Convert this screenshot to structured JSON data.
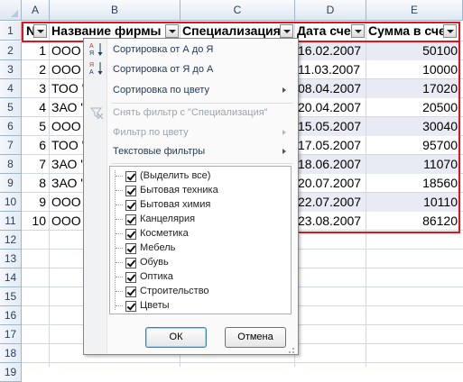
{
  "columns": [
    "A",
    "B",
    "C",
    "D",
    "E"
  ],
  "rows": [
    "1",
    "2",
    "3",
    "4",
    "5",
    "6",
    "7",
    "8",
    "9",
    "10",
    "11",
    "12",
    "13",
    "14",
    "15",
    "16",
    "17",
    "18",
    "19"
  ],
  "header": {
    "a": "N",
    "b": "Название фирмы",
    "c": "Специализация",
    "d": "Дата сче",
    "e": "Сумма в сче"
  },
  "data_rows": [
    {
      "num": "1",
      "firm": "ООО",
      "date": "16.02.2007",
      "sum": "50100"
    },
    {
      "num": "2",
      "firm": "ООО",
      "date": "11.03.2007",
      "sum": "10000"
    },
    {
      "num": "3",
      "firm": "ТОО '",
      "date": "08.04.2007",
      "sum": "17020"
    },
    {
      "num": "4",
      "firm": "ЗАО '",
      "date": "20.04.2007",
      "sum": "20500"
    },
    {
      "num": "5",
      "firm": "ООО",
      "date": "15.05.2007",
      "sum": "30040"
    },
    {
      "num": "6",
      "firm": "ТОО '",
      "date": "17.05.2007",
      "sum": "95700"
    },
    {
      "num": "7",
      "firm": "ЗАО '",
      "date": "18.06.2007",
      "sum": "11070"
    },
    {
      "num": "8",
      "firm": "ЗАО '",
      "date": "20.07.2007",
      "sum": "18560"
    },
    {
      "num": "9",
      "firm": "ООО",
      "date": "22.07.2007",
      "sum": "10110"
    },
    {
      "num": "10",
      "firm": "ООО",
      "date": "23.08.2007",
      "sum": "86120"
    }
  ],
  "menu": {
    "sort_asc": "Сортировка от А до Я",
    "sort_desc": "Сортировка от Я до А",
    "sort_color": "Сортировка по цвету",
    "clear_filter": "Снять фильтр с \"Специализация\"",
    "filter_color": "Фильтр по цвету",
    "text_filters": "Текстовые фильтры",
    "icon_sort_asc": "sort-a-z-icon",
    "icon_sort_desc": "sort-z-a-icon",
    "icon_clear": "clear-filter-icon"
  },
  "filter_values": [
    "(Выделить все)",
    "Бытовая техника",
    "Бытовая химия",
    "Канцелярия",
    "Косметика",
    "Мебель",
    "Обувь",
    "Оптика",
    "Строительство",
    "Цветы"
  ],
  "buttons": {
    "ok": "ОК",
    "cancel": "Отмена"
  },
  "colors": {
    "highlight_border": "#e0141e",
    "menu_text": "#1e395b",
    "grid_line": "#d0d7e5"
  }
}
